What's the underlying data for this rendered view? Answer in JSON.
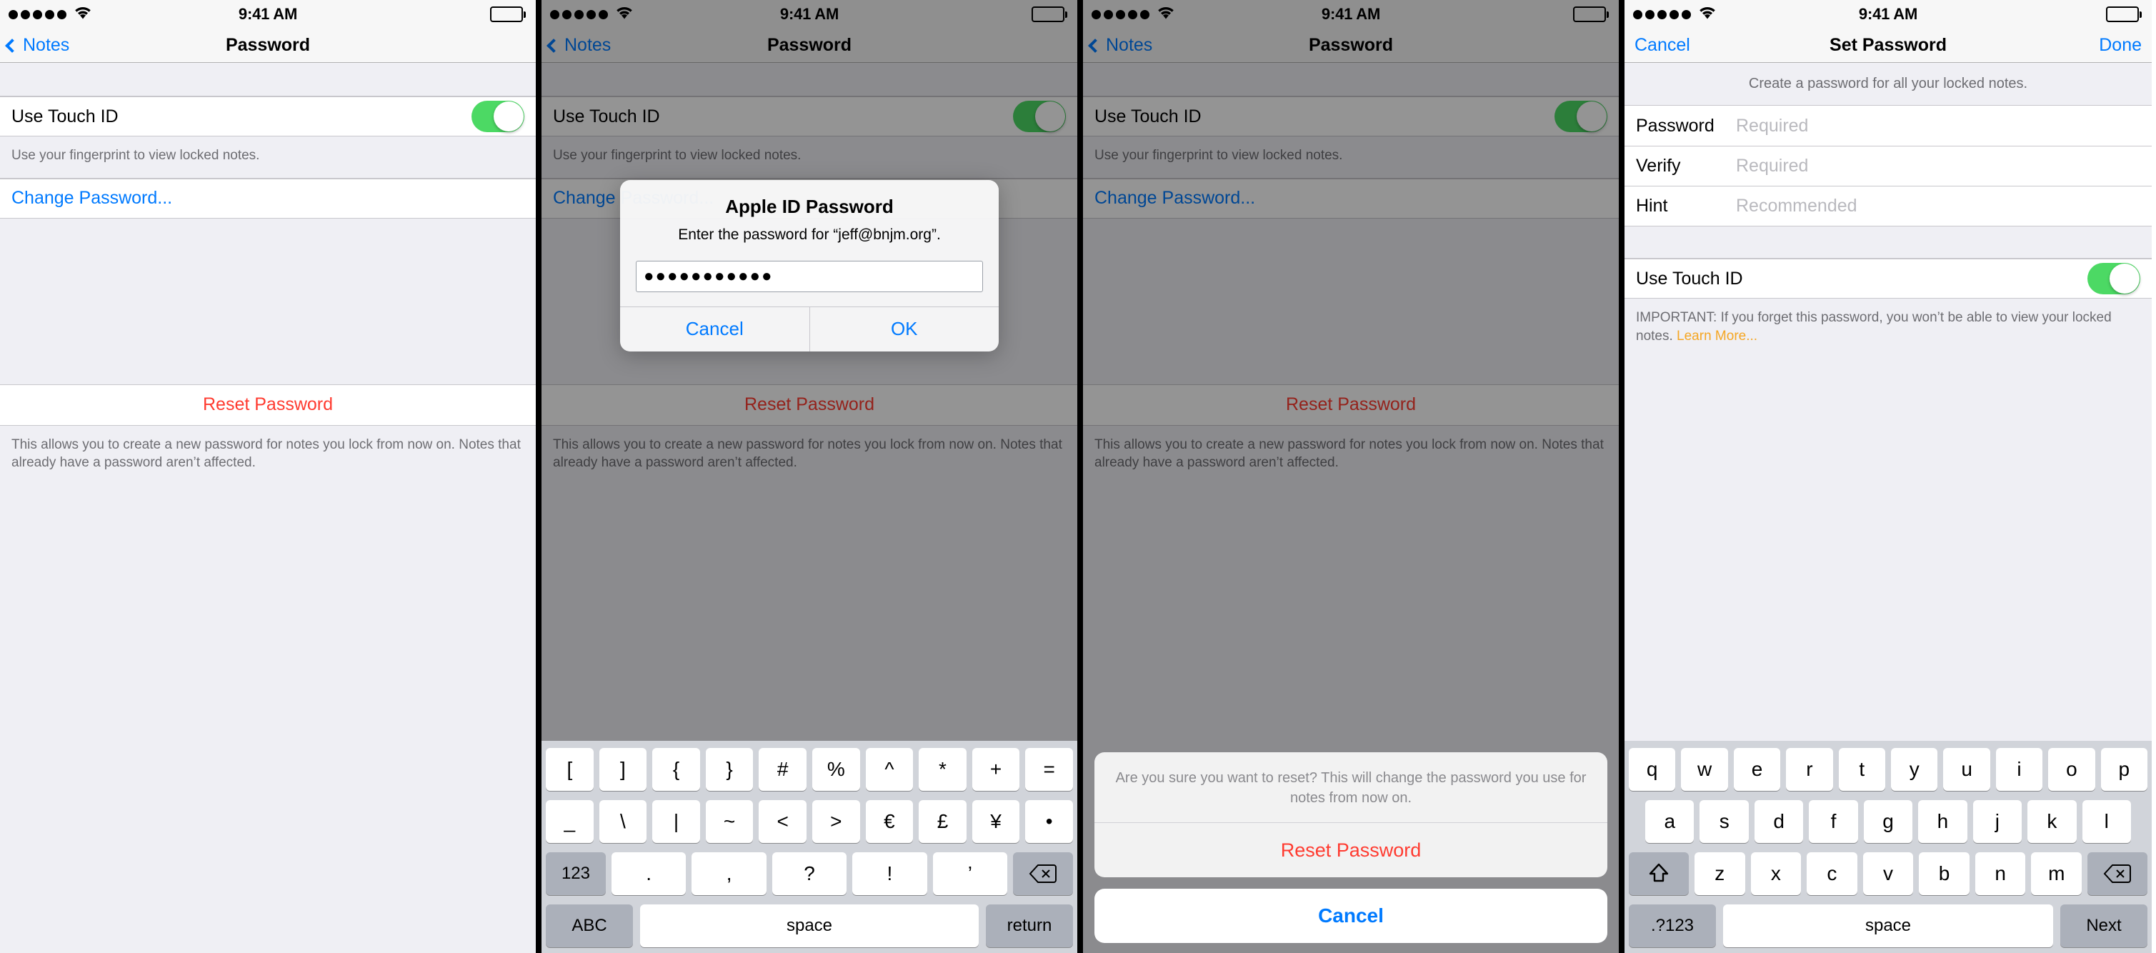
{
  "statusbar": {
    "time": "9:41 AM",
    "signal_dots": 5,
    "wifi": "wifi-icon",
    "battery": "battery-full-icon"
  },
  "colors": {
    "tint": "#007AFF",
    "destructive": "#FF3B30",
    "switch_on": "#4CD964",
    "learn_more": "#F5A623"
  },
  "panel1": {
    "nav": {
      "back": "Notes",
      "title": "Password"
    },
    "touch_id_label": "Use Touch ID",
    "touch_id_on": true,
    "touch_id_footnote": "Use your fingerprint to view locked notes.",
    "change_password": "Change Password...",
    "reset_password": "Reset Password",
    "reset_footnote": "This allows you to create a new password for notes you lock from now on. Notes that already have a password aren’t affected."
  },
  "panel2": {
    "nav": {
      "back": "Notes",
      "title": "Password"
    },
    "touch_id_label": "Use Touch ID",
    "touch_id_footnote": "Use your fingerprint to view locked notes.",
    "change_password": "Change Password...",
    "reset_password": "Reset Password",
    "reset_footnote": "This allows you to create a new password for notes you lock from now on. Notes that already have a password aren’t affected.",
    "alert": {
      "title": "Apple ID Password",
      "message": "Enter the password for “jeff@bnjm.org”.",
      "password_value": "●●●●●●●●●●●",
      "cancel": "Cancel",
      "ok": "OK"
    },
    "keyboard": {
      "row1": [
        "[",
        "]",
        "{",
        "}",
        "#",
        "%",
        "^",
        "*",
        "+",
        "="
      ],
      "row2": [
        "_",
        "\\",
        "|",
        "~",
        "<",
        ">",
        "€",
        "£",
        "¥",
        "•"
      ],
      "row3": [
        ".",
        ",",
        "?",
        "!",
        "’"
      ],
      "num_key": "123",
      "delete_key": "delete-icon",
      "abc_key": "ABC",
      "space_key": "space",
      "return_key": "return"
    }
  },
  "panel3": {
    "nav": {
      "back": "Notes",
      "title": "Password"
    },
    "touch_id_label": "Use Touch ID",
    "touch_id_footnote": "Use your fingerprint to view locked notes.",
    "change_password": "Change Password...",
    "reset_password": "Reset Password",
    "reset_footnote": "This allows you to create a new password for notes you lock from now on. Notes that already have a password aren’t affected.",
    "sheet": {
      "message": "Are you sure you want to reset? This will change the password you use for notes from now on.",
      "destructive": "Reset Password",
      "cancel": "Cancel"
    }
  },
  "panel4": {
    "nav": {
      "left": "Cancel",
      "title": "Set Password",
      "right": "Done"
    },
    "header_note": "Create a password for all your locked notes.",
    "fields": [
      {
        "label": "Password",
        "placeholder": "Required"
      },
      {
        "label": "Verify",
        "placeholder": "Required"
      },
      {
        "label": "Hint",
        "placeholder": "Recommended"
      }
    ],
    "touch_id_label": "Use Touch ID",
    "touch_id_on": true,
    "important_text": "IMPORTANT: If you forget this password, you won’t be able to view your locked notes. ",
    "learn_more": "Learn More...",
    "keyboard": {
      "row1": [
        "q",
        "w",
        "e",
        "r",
        "t",
        "y",
        "u",
        "i",
        "o",
        "p"
      ],
      "row2": [
        "a",
        "s",
        "d",
        "f",
        "g",
        "h",
        "j",
        "k",
        "l"
      ],
      "row3": [
        "z",
        "x",
        "c",
        "v",
        "b",
        "n",
        "m"
      ],
      "shift_key": "shift-icon",
      "delete_key": "delete-icon",
      "num_key": ".?123",
      "space_key": "space",
      "next_key": "Next"
    }
  }
}
